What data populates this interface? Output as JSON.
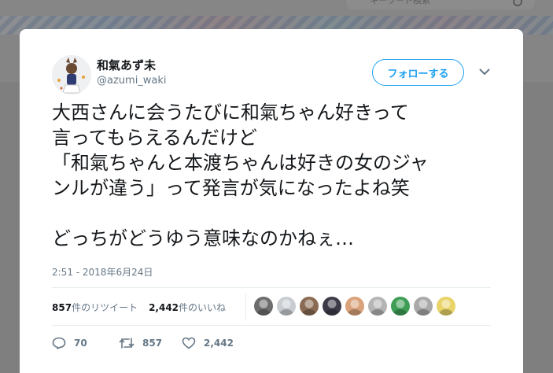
{
  "background": {
    "search_placeholder": "キーワード検索"
  },
  "tweet": {
    "user": {
      "display_name": "和氣あず未",
      "handle": "@azumi_waki"
    },
    "follow_label": "フォローする",
    "text_lines": [
      "大西さんに会うたびに和氣ちゃん好きって",
      "言ってもらえるんだけど",
      "「和氣ちゃんと本渡ちゃんは好きの女のジャ",
      "ンルが違う」って発言が気になったよね笑",
      "",
      "どっちがどうゆう意味なのかねぇ…"
    ],
    "timestamp": "2:51 - 2018年6月24日",
    "stats": {
      "retweets_count": "857",
      "retweets_label": "件のリツイート",
      "likes_count": "2,442",
      "likes_label": "件のいいね"
    },
    "liker_avatars": [
      {
        "icon": "avatar-gray-person",
        "color": "#6d6d6d"
      },
      {
        "icon": "avatar-white-figure",
        "color": "#c9cdd2"
      },
      {
        "icon": "avatar-girl-brown-hair",
        "color": "#8a6a52"
      },
      {
        "icon": "avatar-dark-character",
        "color": "#3d3a48"
      },
      {
        "icon": "avatar-glasses-face",
        "color": "#d9a27a"
      },
      {
        "icon": "avatar-sketch-art",
        "color": "#b4b4b4"
      },
      {
        "icon": "avatar-green-ball",
        "color": "#3f9e55"
      },
      {
        "icon": "avatar-gray-blob",
        "color": "#a9a9a9"
      },
      {
        "icon": "avatar-blonde-character",
        "color": "#e9d46a"
      }
    ],
    "actions": {
      "reply_count": "70",
      "retweet_count": "857",
      "like_count": "2,442"
    },
    "colors": {
      "accent": "#1da1f2",
      "text": "#14171a",
      "muted": "#657786"
    }
  }
}
